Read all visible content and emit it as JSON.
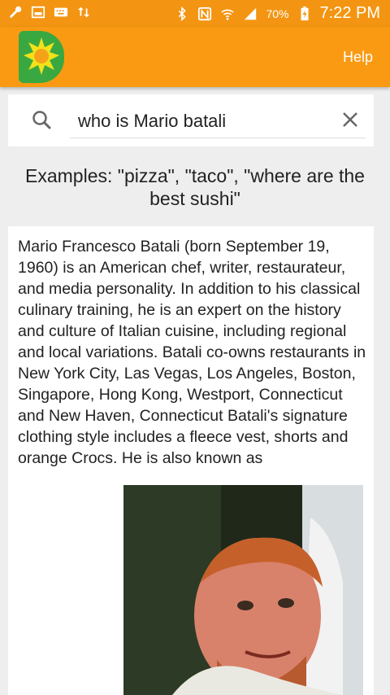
{
  "status_bar": {
    "battery_percent": "70%",
    "time": "7:22 PM",
    "icons": [
      "wrench-icon",
      "image-icon",
      "sync-icon",
      "bluetooth-icon",
      "nfc-icon",
      "wifi-icon",
      "signal-icon",
      "battery-charging-icon"
    ]
  },
  "app_bar": {
    "help_label": "Help",
    "logo": "app-logo"
  },
  "search": {
    "query": "who is Mario batali",
    "icons": [
      "search-icon",
      "clear-icon"
    ]
  },
  "examples_text": "Examples: \"pizza\", \"taco\", \"where are the best sushi\"",
  "result": {
    "text": "Mario Francesco Batali (born September 19, 1960) is an American chef, writer, restaurateur, and media personality. In addition to his classical culinary training, he is an expert on the history and culture of Italian cuisine, including regional and local variations. Batali co-owns restaurants in New York City, Las Vegas, Los Angeles, Boston, Singapore, Hong Kong, Westport, Connecticut and New Haven, Connecticut Batali's signature clothing style includes a fleece vest, shorts and orange Crocs. He is also known as"
  },
  "colors": {
    "accent": "#fa9a12",
    "status_bar": "#f39512",
    "logo_green": "#3aa841"
  }
}
